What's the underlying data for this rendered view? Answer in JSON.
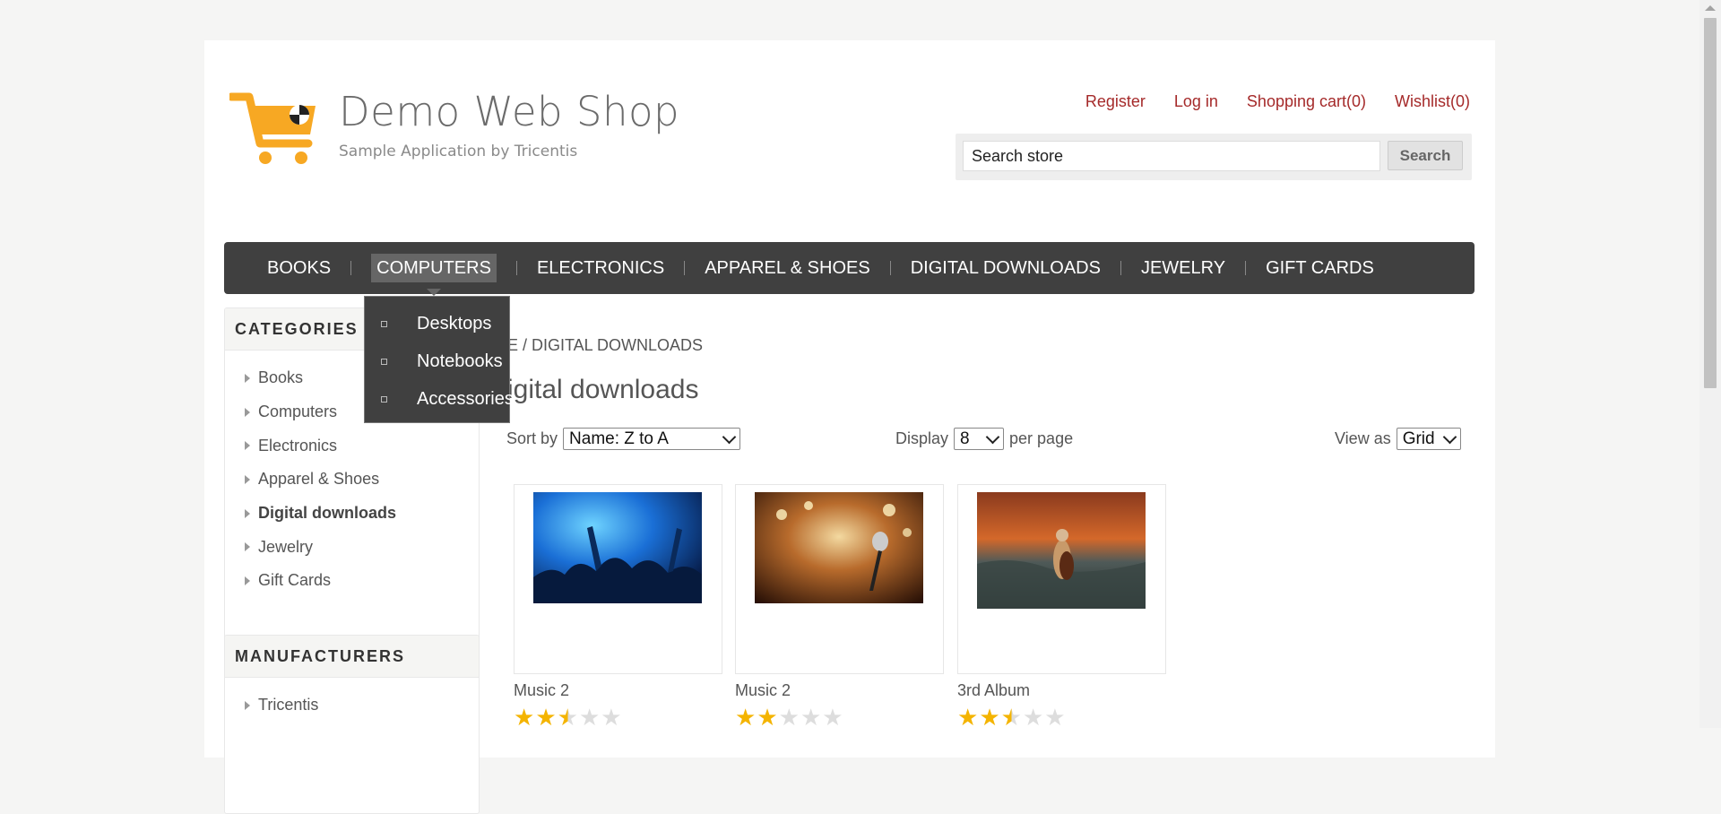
{
  "header": {
    "logo_title": "Demo Web Shop",
    "logo_subtitle": "Sample Application by Tricentis",
    "links": [
      "Register",
      "Log in",
      "Shopping cart(0)",
      "Wishlist(0)"
    ]
  },
  "search": {
    "value": "Search store",
    "button_label": "Search"
  },
  "menu": {
    "items": [
      "BOOKS",
      "COMPUTERS",
      "ELECTRONICS",
      "APPAREL & SHOES",
      "DIGITAL DOWNLOADS",
      "JEWELRY",
      "GIFT CARDS"
    ],
    "active": "COMPUTERS",
    "dropdown": [
      "Desktops",
      "Notebooks",
      "Accessories"
    ]
  },
  "sidebar": {
    "categories_title": "CATEGORIES",
    "categories": [
      "Books",
      "Computers",
      "Electronics",
      "Apparel & Shoes",
      "Digital downloads",
      "Jewelry",
      "Gift Cards"
    ],
    "active_category": "Digital downloads",
    "manufacturers_title": "MANUFACTURERS",
    "manufacturers": [
      "Tricentis"
    ]
  },
  "main": {
    "breadcrumb_visible": "E / DIGITAL DOWNLOADS",
    "title_visible": "igital downloads",
    "sort_label": "Sort by",
    "sort_value": "Name: Z to A",
    "display_label": "Display",
    "display_value": "8",
    "per_page_label": "per page",
    "view_label": "View as",
    "view_value": "Grid"
  },
  "products": [
    {
      "name": "Music 2",
      "rating": 2.5,
      "image": "concert-crowd-image"
    },
    {
      "name": "Music 2",
      "rating": 2,
      "image": "microphone-image"
    },
    {
      "name": "3rd Album",
      "rating": 2.5,
      "image": "cellist-sea-image"
    }
  ],
  "colors": {
    "link": "#a52a2a",
    "menu_bg": "#404040",
    "star": "#f4b400",
    "logo_cart": "#f7a823"
  }
}
